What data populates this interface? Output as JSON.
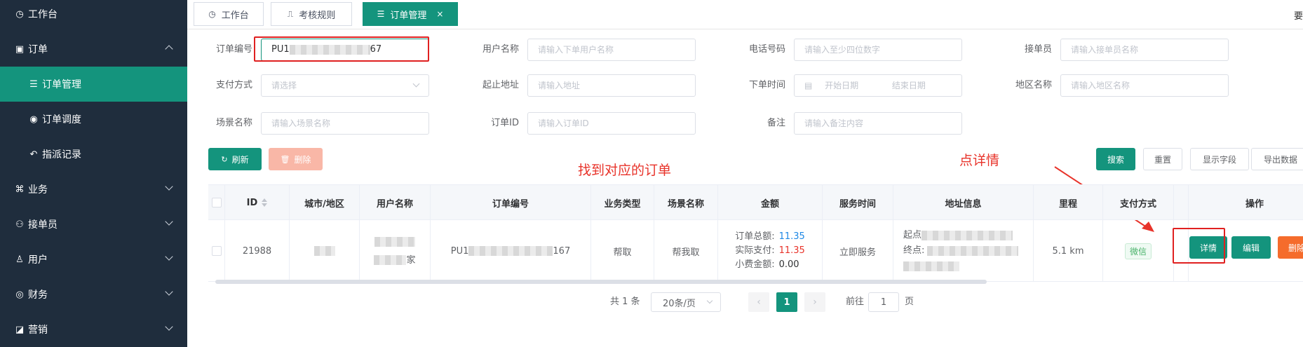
{
  "sidebar": {
    "items": [
      {
        "label": "工作台",
        "icon": "dashboard-icon"
      },
      {
        "label": "订单",
        "icon": "order-icon"
      },
      {
        "label": "订单管理",
        "icon": "list-icon"
      },
      {
        "label": "订单调度",
        "icon": "location-icon"
      },
      {
        "label": "指派记录",
        "icon": "assign-icon"
      },
      {
        "label": "业务",
        "icon": "business-icon"
      },
      {
        "label": "接单员",
        "icon": "rider-icon"
      },
      {
        "label": "用户",
        "icon": "user-icon"
      },
      {
        "label": "财务",
        "icon": "finance-icon"
      },
      {
        "label": "营销",
        "icon": "marketing-icon"
      }
    ]
  },
  "tabs": [
    {
      "label": "工作台"
    },
    {
      "label": "考核规则"
    },
    {
      "label": "订单管理",
      "close": "×"
    }
  ],
  "tabbar_cut": "要",
  "filters": {
    "order_no_label": "订单编号",
    "order_no_value_prefix": "PU1",
    "order_no_value_suffix": "67",
    "user_name_label": "用户名称",
    "user_name_placeholder": "请输入下单用户名称",
    "phone_label": "电话号码",
    "phone_placeholder": "请输入至少四位数字",
    "rider_label": "接单员",
    "rider_placeholder": "请输入接单员名称",
    "pay_label": "支付方式",
    "pay_placeholder": "请选择",
    "address_label": "起止地址",
    "address_placeholder": "请输入地址",
    "time_label": "下单时间",
    "time_start": "开始日期",
    "time_end": "结束日期",
    "region_label": "地区名称",
    "region_placeholder": "请输入地区名称",
    "scene_label": "场景名称",
    "scene_placeholder": "请输入场景名称",
    "order_id_label": "订单ID",
    "order_id_placeholder": "请输入订单ID",
    "remark_label": "备注",
    "remark_placeholder": "请输入备注内容"
  },
  "toolbar": {
    "refresh": "刷新",
    "delete": "删除",
    "search": "搜索",
    "reset": "重置",
    "show_fields": "显示字段",
    "export": "导出数据"
  },
  "annotations": {
    "find_order": "找到对应的订单",
    "click_detail": "点详情"
  },
  "table": {
    "headers": [
      "ID",
      "城市/地区",
      "用户名称",
      "订单编号",
      "业务类型",
      "场景名称",
      "金额",
      "服务时间",
      "地址信息",
      "里程",
      "支付方式",
      "操作"
    ],
    "row": {
      "id": "21988",
      "user_suffix": "家",
      "order_prefix": "PU1",
      "order_suffix": "167",
      "biz_type": "帮取",
      "scene": "帮我取",
      "total_label": "订单总额:",
      "total_value": "11.35",
      "paid_label": "实际支付:",
      "paid_value": "11.35",
      "tip_label": "小费金额:",
      "tip_value": "0.00",
      "service_time": "立即服务",
      "start_prefix": "起点",
      "end_prefix": "终点:",
      "mileage": "5.1 km",
      "pay_method": "微信",
      "detail": "详情",
      "edit": "编辑",
      "delete": "删除"
    }
  },
  "pagination": {
    "total": "共 1 条",
    "page_size": "20条/页",
    "current": "1",
    "goto_label": "前往",
    "goto_value": "1",
    "page_unit": "页"
  },
  "colors": {
    "primary": "#14947d",
    "sidebar": "#1f2d3d",
    "annotation": "#e8332a"
  }
}
